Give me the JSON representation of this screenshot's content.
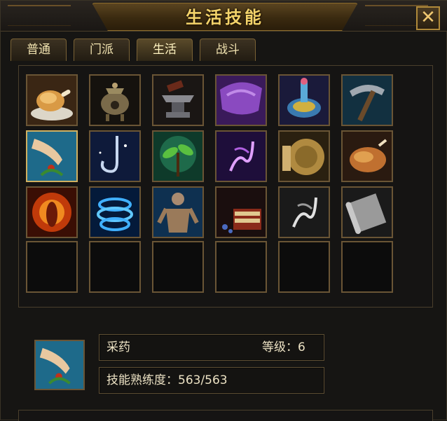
{
  "window": {
    "title": "生活技能",
    "close_label": "✕"
  },
  "tabs": [
    {
      "label": "普通",
      "active": false
    },
    {
      "label": "门派",
      "active": false
    },
    {
      "label": "生活",
      "active": true
    },
    {
      "label": "战斗",
      "active": false
    }
  ],
  "skills": [
    {
      "icon": "roast-chicken-icon"
    },
    {
      "icon": "incense-burner-icon"
    },
    {
      "icon": "anvil-icon"
    },
    {
      "icon": "tailoring-cloth-icon"
    },
    {
      "icon": "alchemy-flask-icon"
    },
    {
      "icon": "pickaxe-mining-icon"
    },
    {
      "icon": "herb-gathering-icon"
    },
    {
      "icon": "hook-fishing-icon"
    },
    {
      "icon": "sprout-planting-icon"
    },
    {
      "icon": "purple-dance-icon"
    },
    {
      "icon": "bronze-gong-icon"
    },
    {
      "icon": "roast-duck-icon"
    },
    {
      "icon": "fire-aura-icon"
    },
    {
      "icon": "water-aura-icon"
    },
    {
      "icon": "muscle-training-icon"
    },
    {
      "icon": "bookbinding-icon"
    },
    {
      "icon": "white-dance-icon"
    },
    {
      "icon": "scroll-icon"
    }
  ],
  "empty_slots": 6,
  "selected_skill": {
    "name": "采药",
    "level_label": "等级：6",
    "proficiency_label": "技能熟练度：563/563",
    "icon": "herb-gathering-icon"
  }
}
